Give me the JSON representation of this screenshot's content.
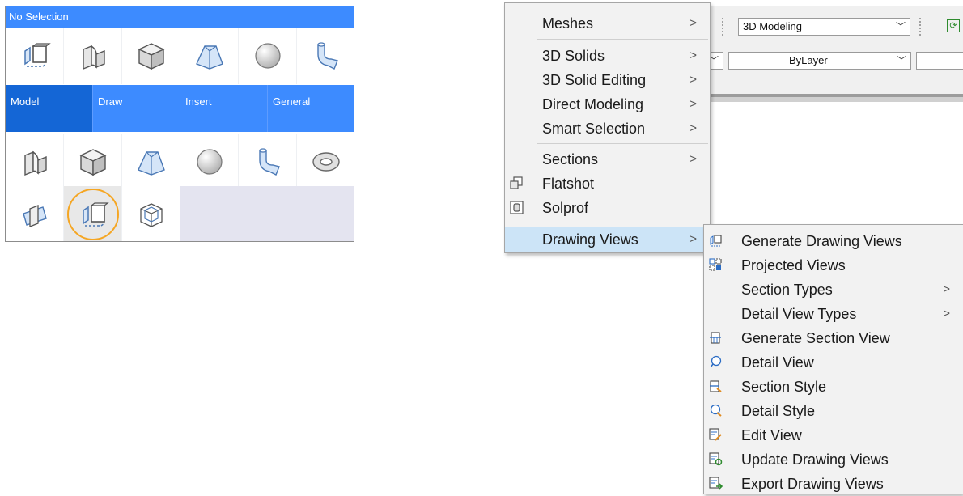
{
  "quad": {
    "title": "No Selection",
    "tabs": [
      "Model",
      "Draw",
      "Insert",
      "General"
    ],
    "row1_icons": [
      "drawing-views-icon",
      "extrude-icon",
      "box-icon",
      "loft-icon",
      "sphere-icon",
      "sweep-icon"
    ],
    "row2_icons": [
      "extrude-icon",
      "box-icon",
      "loft-icon",
      "sphere-icon",
      "sweep-icon",
      "torus-icon"
    ],
    "row3_icons": [
      "slice-icon",
      "drawing-views-icon",
      "wireframe-cube-icon"
    ]
  },
  "toolbar": {
    "workspace": "3D Modeling",
    "linetype": "ByLayer"
  },
  "menu": {
    "items": [
      {
        "label": "Meshes",
        "submenu": true
      },
      {
        "label": "3D Solids",
        "submenu": true
      },
      {
        "label": "3D Solid Editing",
        "submenu": true
      },
      {
        "label": "Direct Modeling",
        "submenu": true
      },
      {
        "label": "Smart Selection",
        "submenu": true
      },
      {
        "label": "Sections",
        "submenu": true
      },
      {
        "label": "Flatshot",
        "submenu": false
      },
      {
        "label": "Solprof",
        "submenu": false
      },
      {
        "label": "Drawing Views",
        "submenu": true
      }
    ]
  },
  "submenu": {
    "items": [
      {
        "label": "Generate Drawing Views",
        "submenu": false
      },
      {
        "label": "Projected Views",
        "submenu": false
      },
      {
        "label": "Section Types",
        "submenu": true
      },
      {
        "label": "Detail View Types",
        "submenu": true
      },
      {
        "label": "Generate Section View",
        "submenu": false
      },
      {
        "label": "Detail View",
        "submenu": false
      },
      {
        "label": "Section Style",
        "submenu": false
      },
      {
        "label": "Detail Style",
        "submenu": false
      },
      {
        "label": "Edit View",
        "submenu": false
      },
      {
        "label": "Update Drawing Views",
        "submenu": false
      },
      {
        "label": "Export Drawing Views",
        "submenu": false
      }
    ]
  },
  "glyphs": {
    "arrow": ">",
    "dropdown": "﹀"
  },
  "colors": {
    "accent": "#3d8bff",
    "active_tab": "#1466d6",
    "highlight": "#cce4f7",
    "selection_ring": "#f5a623"
  }
}
